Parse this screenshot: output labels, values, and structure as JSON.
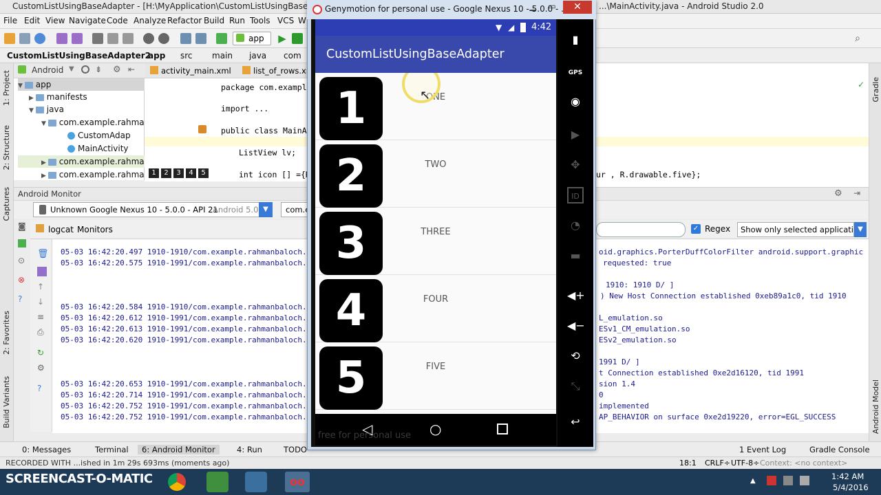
{
  "ide": {
    "title_left": "CustomListUsingBaseAdapter - [H:\\MyApplication\\CustomListUsingBaseAdapter2] - ...",
    "title_right": "...\\MainActivity.java - Android Studio 2.0",
    "menu": [
      "File",
      "Edit",
      "View",
      "Navigate",
      "Code",
      "Analyze",
      "Refactor",
      "Build",
      "Run",
      "Tools",
      "VCS",
      "W"
    ],
    "run_config": "app",
    "breadcrumbs": [
      "CustomListUsingBaseAdapter2",
      "app",
      "src",
      "main",
      "java",
      "com"
    ],
    "project_view": "Android",
    "tree": [
      {
        "label": "app",
        "indent": 0,
        "kind": "folder"
      },
      {
        "label": "manifests",
        "indent": 1,
        "kind": "folder"
      },
      {
        "label": "java",
        "indent": 1,
        "kind": "folder"
      },
      {
        "label": "com.example.rahma",
        "indent": 2,
        "kind": "folder"
      },
      {
        "label": "CustomAdap",
        "indent": 3,
        "kind": "class"
      },
      {
        "label": "MainActivity",
        "indent": 3,
        "kind": "class"
      },
      {
        "label": "com.example.rahma",
        "indent": 2,
        "kind": "folder"
      },
      {
        "label": "com.example.rahma",
        "indent": 2,
        "kind": "folder"
      }
    ],
    "editor_tabs": [
      "activity_main.xml",
      "list_of_rows.xm"
    ],
    "code_lines": [
      "package com.example",
      "import ...",
      "public class MainAc",
      "ListView lv;",
      "int icon [] ={R"
    ],
    "code_right": "ur , R.drawable.five};",
    "bookmarks": [
      "1",
      "2",
      "3",
      "4",
      "5"
    ],
    "monitor_title": "Android Monitor",
    "device_select": "Unknown Google Nexus 10 - 5.0.0 - API 21",
    "device_sub": "Android 5.0, API 21",
    "process_select": "com.e",
    "logcat_tabs": [
      "logcat",
      "Monitors"
    ],
    "regex_label": "Regex",
    "filter_select": "Show only selected application",
    "log_left": [
      "05-03 16:42:20.497 1910-1910/com.example.rahmanbaloch.",
      "05-03 16:42:20.575 1910-1991/com.example.rahmanbaloch.",
      "",
      "",
      "",
      "05-03 16:42:20.584 1910-1910/com.example.rahmanbaloch.",
      "05-03 16:42:20.612 1910-1991/com.example.rahmanbaloch.",
      "05-03 16:42:20.613 1910-1991/com.example.rahmanbaloch.",
      "05-03 16:42:20.620 1910-1991/com.example.rahmanbaloch.",
      "",
      "",
      "",
      "05-03 16:42:20.653 1910-1991/com.example.rahmanbaloch.",
      "05-03 16:42:20.714 1910-1991/com.example.rahmanbaloch.",
      "05-03 16:42:20.752 1910-1991/com.example.rahmanbaloch.",
      "05-03 16:42:20.752 1910-1991/com.example.rahmanbaloch."
    ],
    "log_right": [
      "oid.graphics.PorterDuffColorFilter android.support.graphic",
      "requested: true",
      "",
      "1910: 1910 D/         ]",
      ") New Host Connection established 0xeb89a1c0, tid 1910",
      "",
      "L_emulation.so",
      "ESv1_CM_emulation.so",
      "ESv2_emulation.so",
      "",
      "1991 D/         ]",
      "t Connection established 0xe2d16120, tid 1991",
      "sion 1.4",
      "0",
      "implemented",
      "AP_BEHAVIOR on surface 0xe2d19220, error=EGL_SUCCESS"
    ],
    "bottom_tabs": [
      "0: Messages",
      "Terminal",
      "6: Android Monitor",
      "4: Run",
      "TODO"
    ],
    "bottom_right_tabs": [
      "1 Event Log",
      "Gradle Console"
    ],
    "status_left": "RECORDED WITH ...ished in 1m 29s 693ms (moments ago)",
    "status_pos": "18:1",
    "status_crlf": "CRLF÷",
    "status_enc": "UTF-8÷",
    "status_context": "Context: <no context>",
    "side_labels": [
      "1: Project",
      "2: Structure",
      "Captures",
      "2: Favorites",
      "Build Variants",
      "Gradle",
      "Android Model"
    ]
  },
  "genymotion": {
    "title": "Genymotion for personal use - Google Nexus 10 - 5.0.0 - ...",
    "watermark": "free for personal use",
    "side_labels": [
      "GPS",
      "ID"
    ]
  },
  "phone": {
    "time": "4:42",
    "app_title": "CustomListUsingBaseAdapter",
    "rows": [
      {
        "number": "1",
        "label": "ONE"
      },
      {
        "number": "2",
        "label": "TWO"
      },
      {
        "number": "3",
        "label": "THREE"
      },
      {
        "number": "4",
        "label": "FOUR"
      },
      {
        "number": "5",
        "label": "FIVE"
      }
    ]
  },
  "taskbar": {
    "brand": "SCREENCAST-O-MATIC",
    "time": "1:42 AM",
    "date": "5/4/2016"
  },
  "colors": {
    "appbar": "#3949ab",
    "statusbar": "#2d3db3",
    "taskbar": "#1d3a57"
  }
}
